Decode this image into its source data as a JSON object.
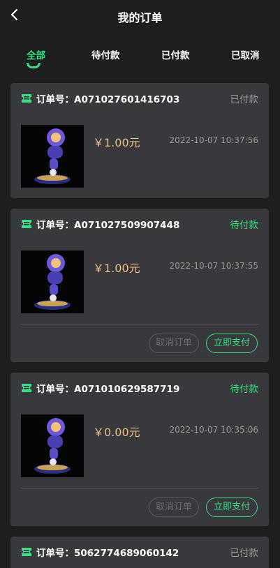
{
  "header": {
    "title": "我的订单",
    "back_icon": "chevron-left-icon"
  },
  "tabs": [
    {
      "label": "全部",
      "active": true
    },
    {
      "label": "待付款",
      "active": false
    },
    {
      "label": "已付款",
      "active": false
    },
    {
      "label": "已取消",
      "active": false
    }
  ],
  "colors": {
    "accent": "#3ddc84",
    "price": "#e8c08a",
    "muted": "#9a9a9a",
    "card": "#37393d",
    "background": "#1d1e20"
  },
  "orders": [
    {
      "order_no": "订单号：A071027601416703",
      "status": "已付款",
      "price": "￥1.00元",
      "date": "2022-10-07 10:37:56",
      "actions": null
    },
    {
      "order_no": "订单号：A071027509907448",
      "status": "待付款",
      "price": "￥1.00元",
      "date": "2022-10-07 10:37:55",
      "actions": {
        "cancel": "取消订单",
        "pay": "立即支付"
      }
    },
    {
      "order_no": "订单号：A071010629587719",
      "status": "待付款",
      "price": "￥0.00元",
      "date": "2022-10-07 10:35:06",
      "actions": {
        "cancel": "取消订单",
        "pay": "立即支付"
      }
    },
    {
      "order_no": "订单号：5062774689060142",
      "status": "已付款"
    }
  ]
}
